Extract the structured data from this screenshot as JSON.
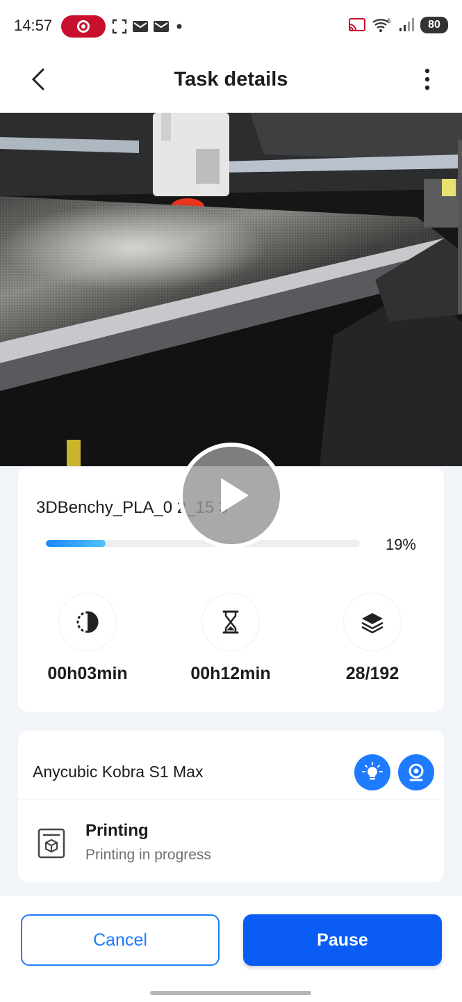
{
  "status_bar": {
    "time": "14:57",
    "battery": "80",
    "icons": [
      "screen-record-icon",
      "screenshot-icon",
      "mail-icon",
      "mail-icon",
      "dot-icon",
      "cast-icon",
      "wifi-6-icon",
      "signal-icon"
    ]
  },
  "header": {
    "title": "Task details",
    "back_icon": "chevron-left-icon",
    "menu_icon": "more-vertical-icon"
  },
  "camera": {
    "play_icon": "play-icon"
  },
  "progress": {
    "file_name": "3DBenchy_PLA_0 2_15 3",
    "percent_label": "19%",
    "percent_value": 0.19,
    "colors": {
      "fill_start": "#1e88ff",
      "fill_end": "#4fc3f7"
    }
  },
  "stats": [
    {
      "icon": "elapsed-time-icon",
      "value": "00h03min"
    },
    {
      "icon": "hourglass-icon",
      "value": "00h12min"
    },
    {
      "icon": "layers-icon",
      "value": "28/192"
    }
  ],
  "printer": {
    "name": "Anycubic Kobra S1 Max",
    "light_icon": "light-bulb-icon",
    "camera_icon": "webcam-icon",
    "status_title": "Printing",
    "status_subtitle": "Printing in progress",
    "status_icon": "printer-box-icon",
    "accent": "#1e7bff"
  },
  "actions": {
    "cancel_label": "Cancel",
    "pause_label": "Pause"
  }
}
